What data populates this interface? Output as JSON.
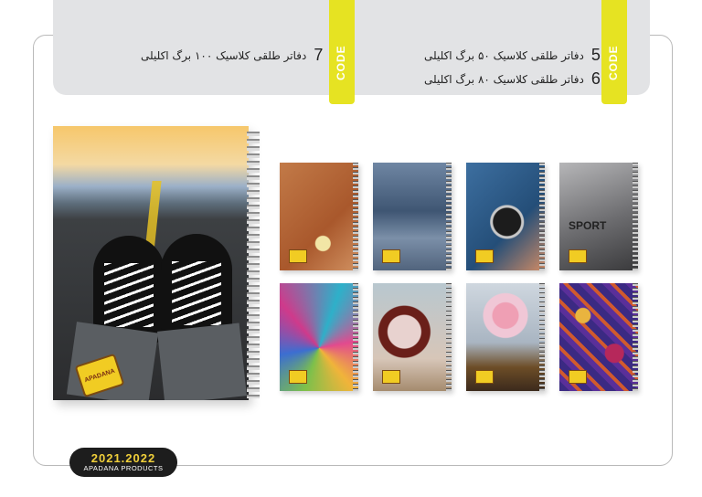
{
  "header": {
    "code_label": "CODE",
    "products": [
      {
        "code": "5",
        "text": "دفاتر طلقی کلاسیک ۵۰ برگ اکلیلی"
      },
      {
        "code": "6",
        "text": "دفاتر طلقی کلاسیک ۸۰ برگ اکلیلی"
      },
      {
        "code": "7",
        "text": "دفاتر طلقی کلاسیک ۱۰۰ برگ اکلیلی"
      }
    ]
  },
  "notebooks": {
    "sport_label": "SPORT",
    "thumbs": [
      "tennis-racket",
      "denim-jeans",
      "wrist-watch",
      "sport-jumper",
      "stained-glass-flower",
      "flowers-collage",
      "flower-vase",
      "paisley-pattern"
    ]
  },
  "footer": {
    "years": "2021.2022",
    "brand": "APADANA PRODUCTS"
  },
  "colors": {
    "accent": "#e6e322",
    "header_bg": "#e2e3e5",
    "badge_bg": "#1d1d1d",
    "badge_text": "#f0cf3a"
  }
}
